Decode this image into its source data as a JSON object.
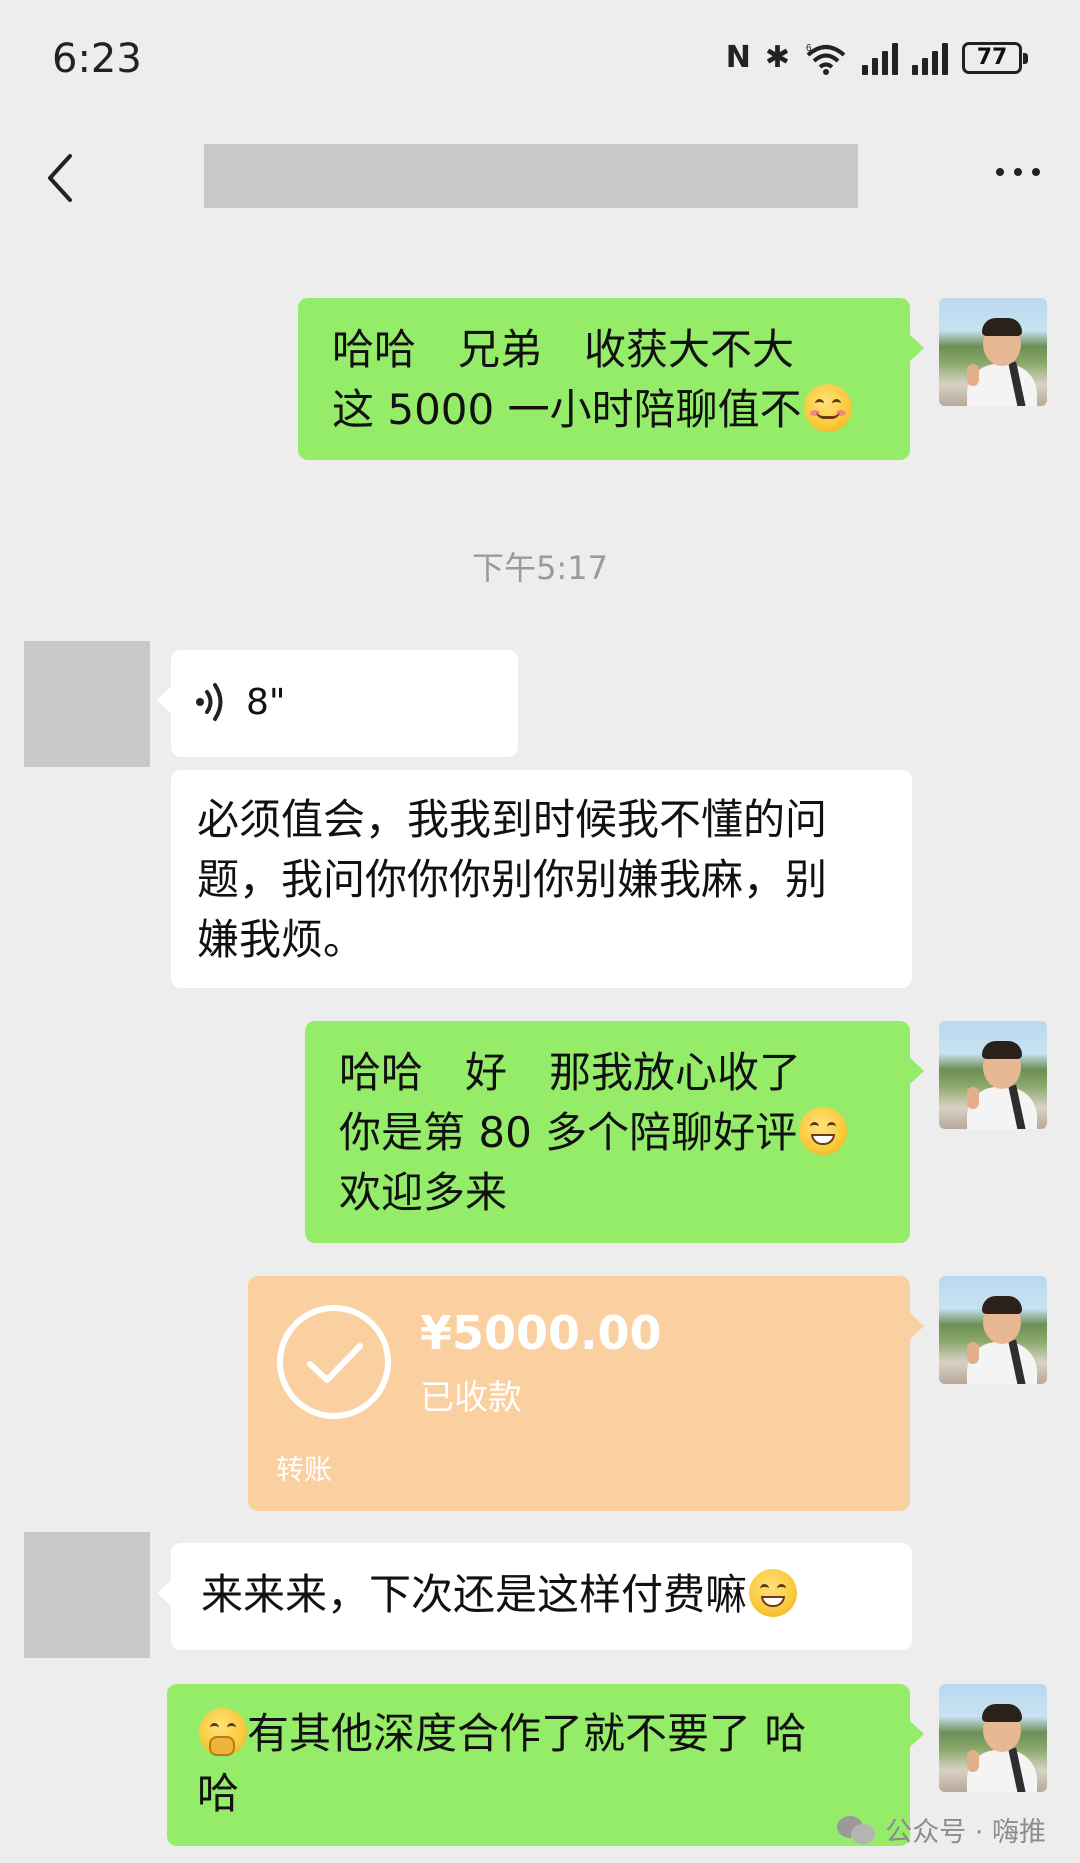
{
  "status_bar": {
    "time": "6:23",
    "nfc": "N",
    "bluetooth": "✱",
    "wifi": "6",
    "battery": "77"
  },
  "nav": {
    "title": ""
  },
  "messages": {
    "m1": {
      "line1": "哈哈　兄弟　收获大不大",
      "line2": "这 5000 一小时陪聊值不"
    },
    "timestamp": "下午5:17",
    "voice": {
      "duration": "8\""
    },
    "m3": {
      "line1": "必须值会，我我到时候我不懂的问",
      "line2": "题，我问你你你别你别嫌我麻，别",
      "line3": "嫌我烦。"
    },
    "m4": {
      "line1": "哈哈　好　那我放心收了",
      "line2": "你是第 80 多个陪聊好评",
      "line3": "欢迎多来"
    },
    "transfer": {
      "amount": "¥5000.00",
      "status": "已收款",
      "label": "转账"
    },
    "m6": {
      "text": "来来来，下次还是这样付费嘛"
    },
    "m7": {
      "line1": "有其他深度合作了就不要了 哈",
      "line2": "哈"
    }
  },
  "watermark": {
    "source": "公众号 · 嗨推"
  },
  "colors": {
    "background": "#ededed",
    "sent_bubble": "#95ec69",
    "received_bubble": "#ffffff",
    "transfer_card": "#fbd0a0"
  }
}
